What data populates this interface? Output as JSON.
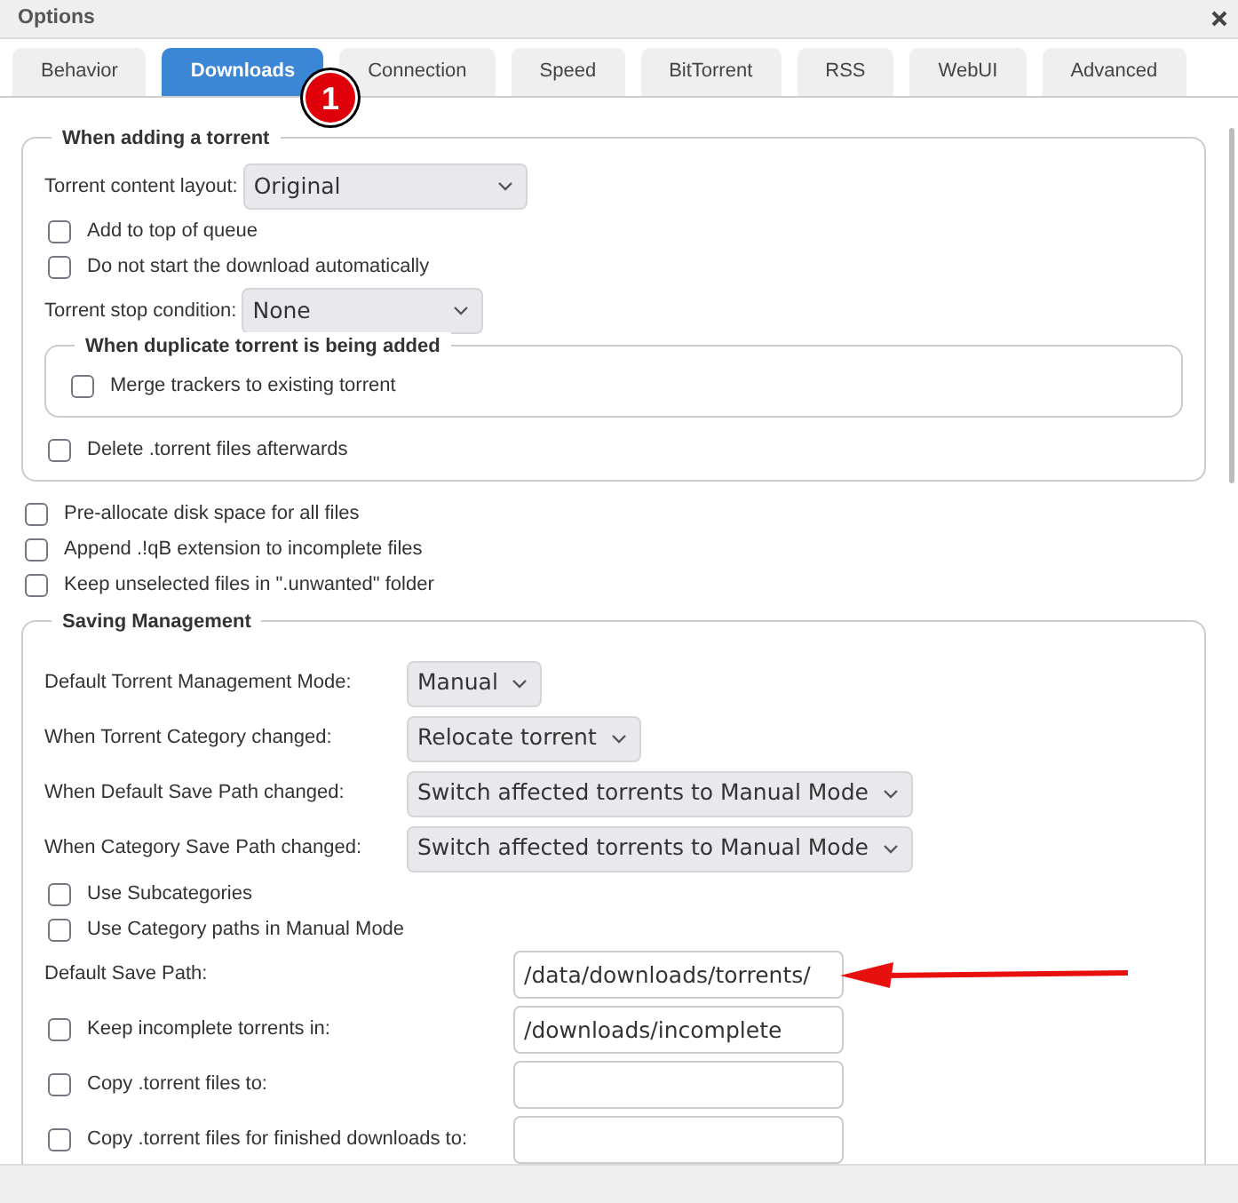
{
  "window": {
    "title": "Options"
  },
  "tabs": [
    {
      "label": "Behavior",
      "selected": false
    },
    {
      "label": "Downloads",
      "selected": true
    },
    {
      "label": "Connection",
      "selected": false
    },
    {
      "label": "Speed",
      "selected": false
    },
    {
      "label": "BitTorrent",
      "selected": false
    },
    {
      "label": "RSS",
      "selected": false
    },
    {
      "label": "WebUI",
      "selected": false
    },
    {
      "label": "Advanced",
      "selected": false
    }
  ],
  "callout": {
    "number": "1"
  },
  "content": [
    {
      "kind": "group",
      "legend": "When adding a torrent",
      "items": [
        {
          "kind": "select",
          "label": "Torrent content layout:",
          "value": "Original"
        },
        {
          "kind": "checkbox",
          "label": "Add to top of queue",
          "checked": false
        },
        {
          "kind": "checkbox",
          "label": "Do not start the download automatically",
          "checked": false
        },
        {
          "kind": "select",
          "label": "Torrent stop condition:",
          "value": "None"
        },
        {
          "kind": "group",
          "legend": "When duplicate torrent is being added",
          "items": [
            {
              "kind": "checkbox",
              "label": "Merge trackers to existing torrent",
              "checked": false
            }
          ]
        },
        {
          "kind": "checkbox",
          "label": "Delete .torrent files afterwards",
          "checked": false
        }
      ]
    },
    {
      "kind": "checkbox",
      "label": "Pre-allocate disk space for all files",
      "checked": false
    },
    {
      "kind": "checkbox",
      "label": "Append .!qB extension to incomplete files",
      "checked": false
    },
    {
      "kind": "checkbox",
      "label": "Keep unselected files in \".unwanted\" folder",
      "checked": false
    },
    {
      "kind": "group",
      "legend": "Saving Management",
      "items": [
        {
          "kind": "select-row",
          "label": "Default Torrent Management Mode:",
          "value": "Manual"
        },
        {
          "kind": "select-row",
          "label": "When Torrent Category changed:",
          "value": "Relocate torrent"
        },
        {
          "kind": "select-row",
          "label": "When Default Save Path changed:",
          "value": "Switch affected torrents to Manual Mode"
        },
        {
          "kind": "select-row",
          "label": "When Category Save Path changed:",
          "value": "Switch affected torrents to Manual Mode"
        },
        {
          "kind": "checkbox",
          "label": "Use Subcategories",
          "checked": false
        },
        {
          "kind": "checkbox",
          "label": "Use Category paths in Manual Mode",
          "checked": false
        },
        {
          "kind": "path",
          "label": "Default Save Path:",
          "value": "/data/downloads/torrents/",
          "annotated": true
        },
        {
          "kind": "path-check",
          "label": "Keep incomplete torrents in:",
          "checked": false,
          "value": "/downloads/incomplete"
        },
        {
          "kind": "path-check",
          "label": "Copy .torrent files to:",
          "checked": false
        },
        {
          "kind": "path-check",
          "label": "Copy .torrent files for finished downloads to:",
          "checked": false
        }
      ]
    }
  ]
}
